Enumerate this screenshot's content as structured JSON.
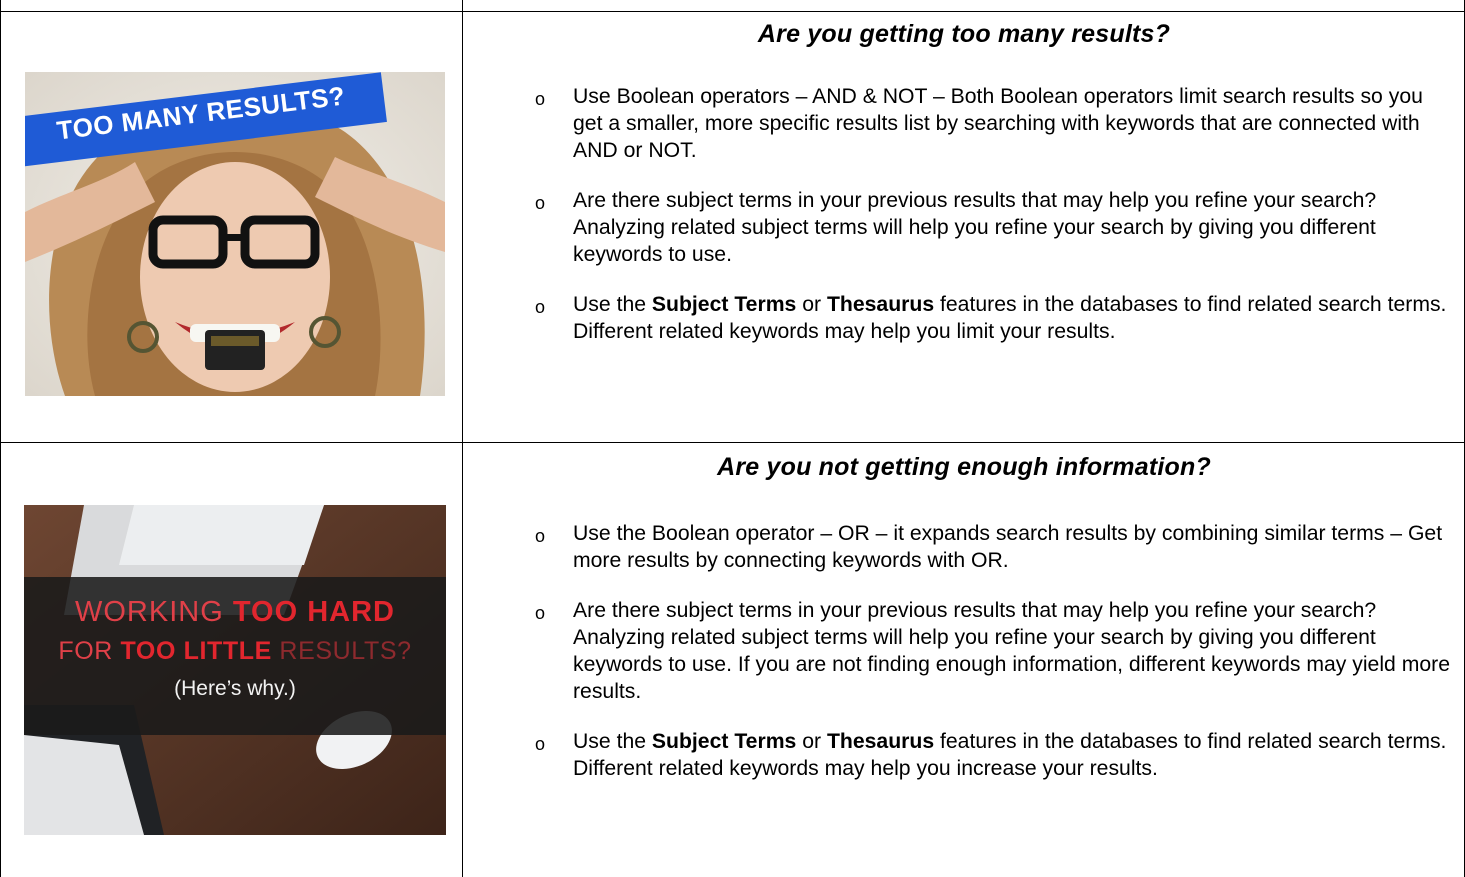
{
  "rows": [
    {
      "heading": "Are you getting too many results?",
      "image": {
        "banner_text": "TOO MANY RESULTS?",
        "alt": "Woman pulling her hair and biting a phone"
      },
      "bullets": [
        {
          "parts": [
            {
              "text": "Use Boolean operators – AND & NOT – Both Boolean operators limit search results  so you get a smaller, more specific results list by searching with keywords that are connected with AND or NOT.",
              "bold": false
            }
          ]
        },
        {
          "parts": [
            {
              "text": "Are there subject terms in your previous results that may help you refine your search? Analyzing related subject terms will help you refine your search by giving you different keywords to use.",
              "bold": false
            }
          ]
        },
        {
          "parts": [
            {
              "text": "Use the ",
              "bold": false
            },
            {
              "text": "Subject Terms",
              "bold": true
            },
            {
              "text": " or ",
              "bold": false
            },
            {
              "text": "Thesaurus",
              "bold": true
            },
            {
              "text": " features in the databases to find related search terms. Different related keywords may help you limit your results.",
              "bold": false
            }
          ]
        }
      ]
    },
    {
      "heading": "Are you not getting enough information?",
      "image": {
        "line1_a": "WORKING ",
        "line1_b": "TOO HARD",
        "line2_a": "FOR ",
        "line2_b": "TOO LITTLE",
        "line2_c": " RESULTS?",
        "line3": "(Here’s why.)",
        "alt": "Laptop and mouse on a desk"
      },
      "bullets": [
        {
          "parts": [
            {
              "text": "Use the Boolean operator – OR – it expands search results by combining similar terms – Get more results by connecting keywords with OR.",
              "bold": false
            }
          ]
        },
        {
          "parts": [
            {
              "text": "Are there subject terms in your previous results that may help you refine your search? Analyzing related subject terms will help you refine your search by giving you different keywords to use. If you are not finding enough information, different keywords may yield more results.",
              "bold": false
            }
          ]
        },
        {
          "parts": [
            {
              "text": "Use the ",
              "bold": false
            },
            {
              "text": "Subject Terms",
              "bold": true
            },
            {
              "text": " or ",
              "bold": false
            },
            {
              "text": "Thesaurus",
              "bold": true
            },
            {
              "text": " features in the databases to find related search terms. Different related keywords may help you increase your results.",
              "bold": false
            }
          ]
        }
      ]
    }
  ],
  "bullet_glyph": "o",
  "colors": {
    "banner_blue": "#1f5bd6",
    "accent_red": "#d8232a",
    "dark_band": "#1a1a1a"
  }
}
